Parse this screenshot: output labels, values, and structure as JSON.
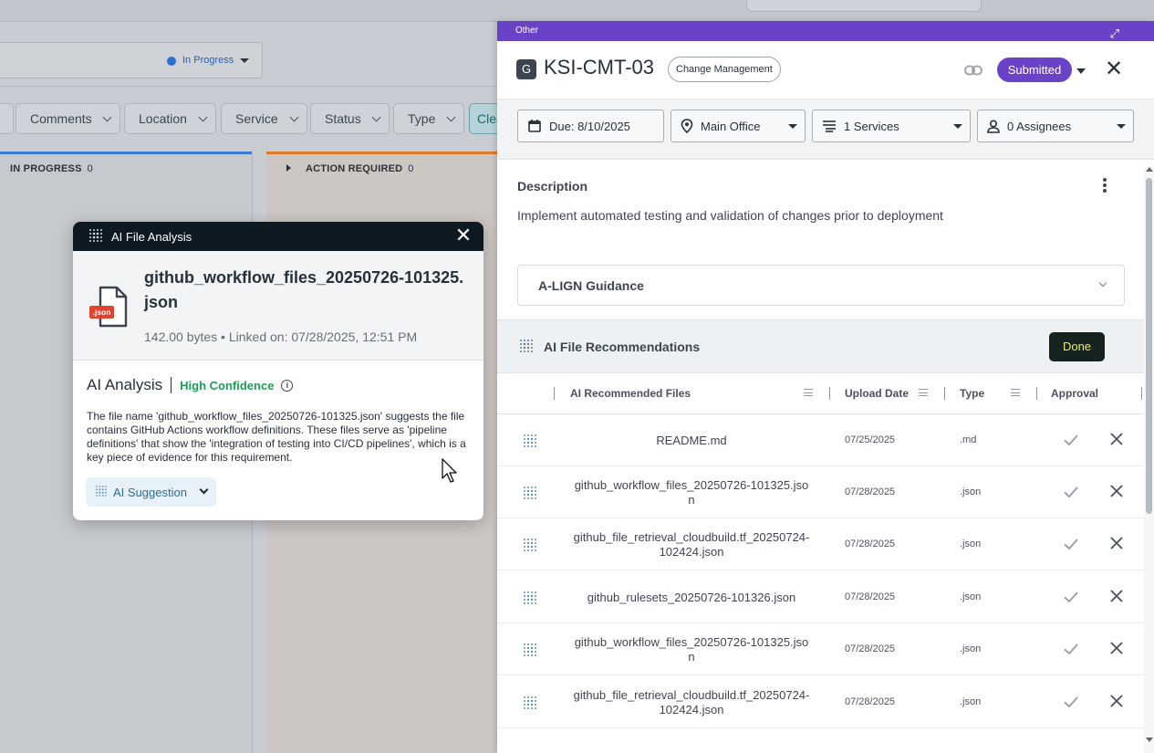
{
  "board": {
    "status_value": "In Progress",
    "filters": [
      "Comments",
      "Location",
      "Service",
      "Status",
      "Type",
      "Clea"
    ],
    "columns": [
      {
        "title": "IN PROGRESS",
        "count": "0",
        "color": "#3b7bd8"
      },
      {
        "title": "ACTION REQUIRED",
        "count": "0",
        "color": "#e07a2c"
      }
    ]
  },
  "modal": {
    "title": "AI File Analysis",
    "file_name": "github_workflow_files_20250726-101325.json",
    "file_badge": ".json",
    "file_meta": "142.00 bytes • Linked on: 07/28/2025, 12:51 PM",
    "analysis_label": "AI Analysis",
    "confidence": "High Confidence",
    "analysis_text": "The file name 'github_workflow_files_20250726-101325.json' suggests the file contains GitHub Actions workflow definitions. These files serve as 'pipeline definitions' that show the 'integration of testing into CI/CD pipelines', which is a key piece of evidence for this requirement.",
    "suggestion_label": "AI Suggestion"
  },
  "panel": {
    "top_label": "Other",
    "badge_letter": "G",
    "req_id": "KSI-CMT-03",
    "category": "Change Management",
    "status": "Submitted",
    "status_color": "#6a42c8",
    "due": "Due: 8/10/2025",
    "location": "Main Office",
    "services": "1 Services",
    "assignees": "0 Assignees",
    "description_title": "Description",
    "description_text": "Implement automated testing and validation of changes prior to deployment",
    "guidance_title": "A-LIGN Guidance",
    "recommendations_title": "AI File Recommendations",
    "done_label": "Done",
    "table_headers": {
      "files": "AI Recommended Files",
      "upload_date": "Upload Date",
      "type": "Type",
      "approval": "Approval"
    },
    "rows": [
      {
        "name": "README.md",
        "date": "07/25/2025",
        "type": ".md"
      },
      {
        "name": "github_workflow_files_20250726-101325.json",
        "date": "07/28/2025",
        "type": ".json"
      },
      {
        "name": "github_file_retrieval_cloudbuild.tf_20250724-102424.json",
        "date": "07/28/2025",
        "type": ".json"
      },
      {
        "name": "github_rulesets_20250726-101326.json",
        "date": "07/28/2025",
        "type": ".json"
      },
      {
        "name": "github_workflow_files_20250726-101325.json",
        "date": "07/28/2025",
        "type": ".json"
      },
      {
        "name": "github_file_retrieval_cloudbuild.tf_20250724-102424.json",
        "date": "07/28/2025",
        "type": ".json"
      }
    ]
  }
}
